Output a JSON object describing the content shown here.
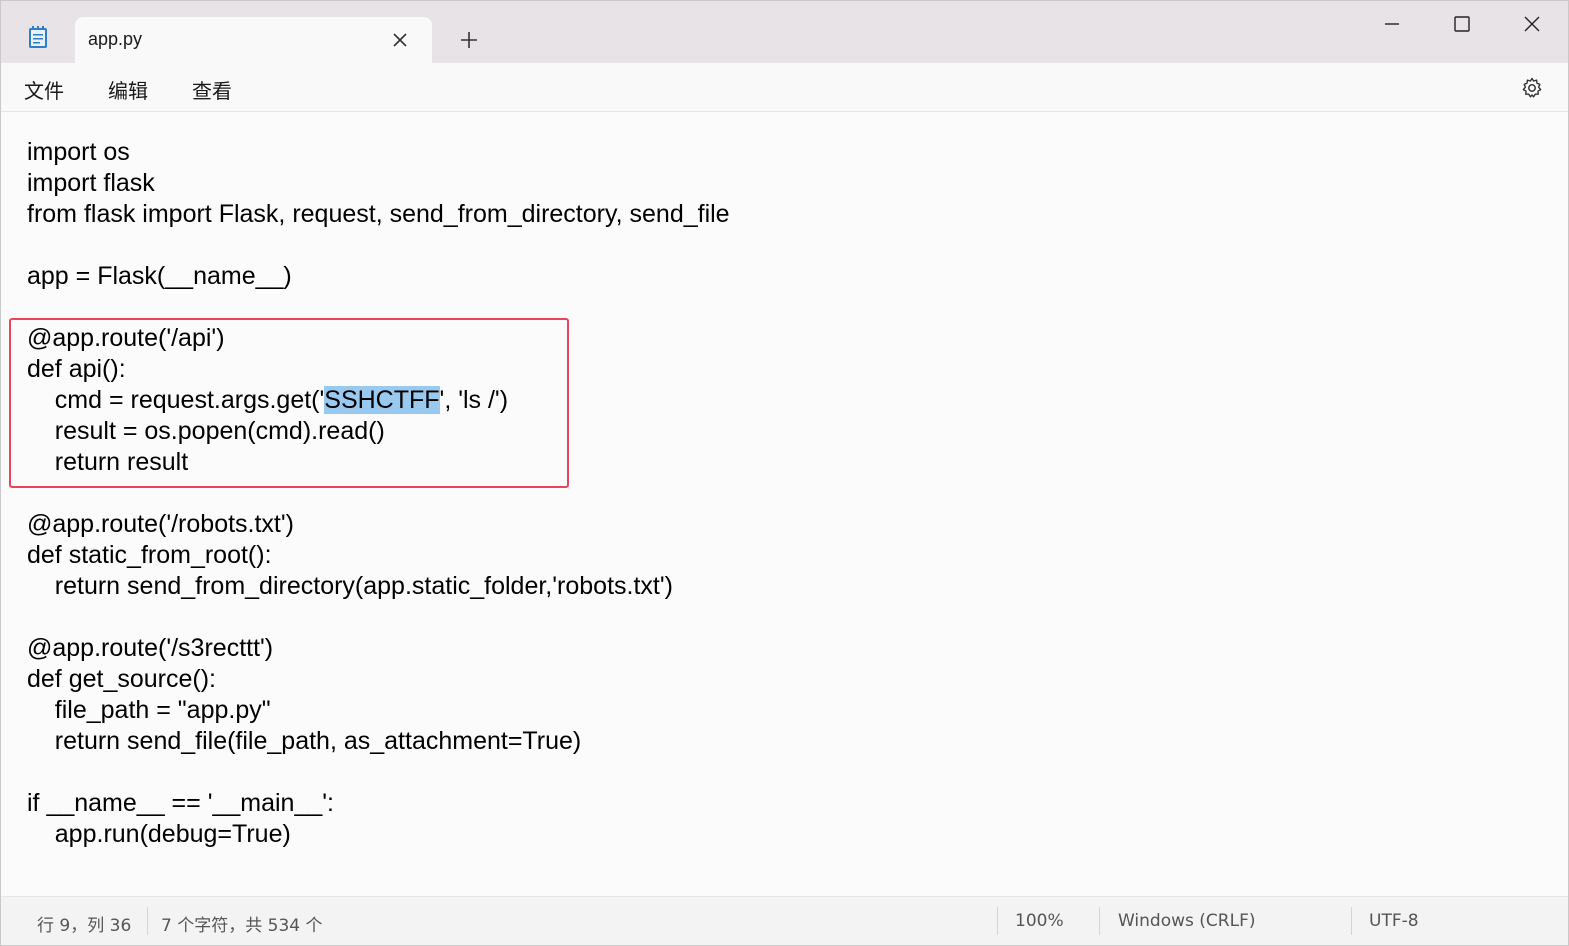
{
  "tab": {
    "title": "app.py"
  },
  "menu": {
    "file": "文件",
    "edit": "编辑",
    "view": "查看"
  },
  "editor": {
    "lines": [
      "import os",
      "import flask",
      "from flask import Flask, request, send_from_directory, send_file",
      "",
      "app = Flask(__name__)",
      "",
      "@app.route('/api')",
      "def api():",
      "    cmd = request.args.get('",
      "    result = os.popen(cmd).read()",
      "    return result",
      "",
      "@app.route('/robots.txt')",
      "def static_from_root():",
      "    return send_from_directory(app.static_folder,'robots.txt')",
      "",
      "@app.route('/s3recttt')",
      "def get_source():",
      "    file_path = \"app.py\"",
      "    return send_file(file_path, as_attachment=True)",
      "",
      "if __name__ == '__main__':",
      "    app.run(debug=True)"
    ],
    "selected_text": "SSHCTFF",
    "after_selection": "', 'ls /')"
  },
  "status": {
    "position": "行 9，列 36",
    "selection": "7 个字符，共 534 个",
    "zoom": "100%",
    "line_ending": "Windows (CRLF)",
    "encoding": "UTF-8"
  },
  "colors": {
    "selection": "#99c9ef",
    "highlight_box": "#e8455b",
    "titlebar": "#e8e3e6"
  }
}
